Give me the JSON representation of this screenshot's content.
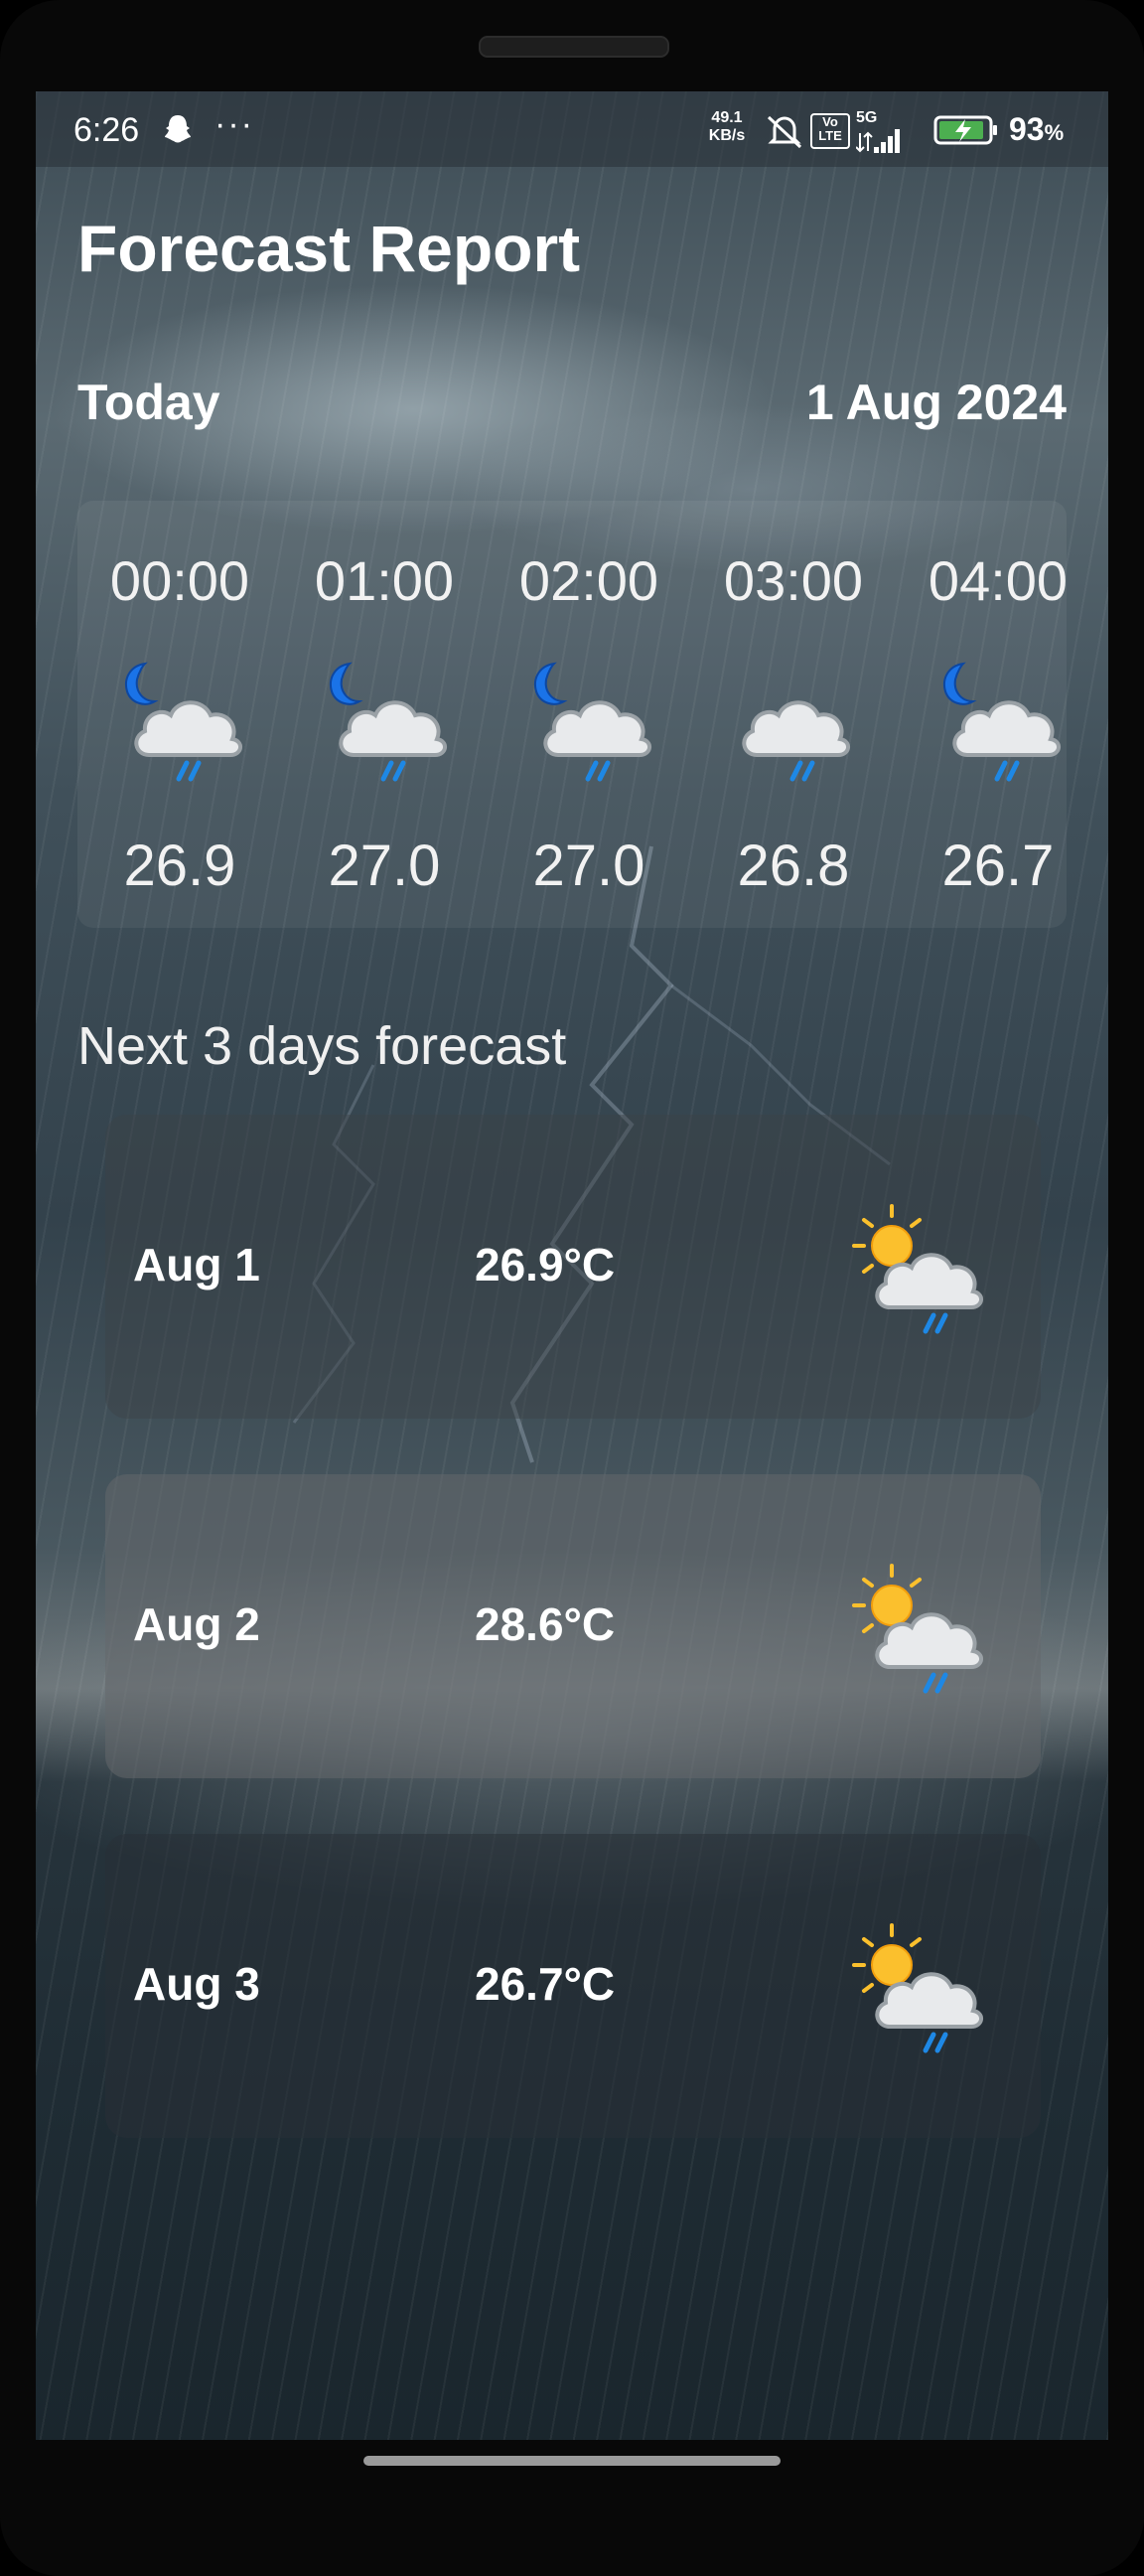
{
  "status_bar": {
    "time": "6:26",
    "overflow": "···",
    "net_speed_value": "49.1",
    "net_speed_unit": "KB/s",
    "volte": "Vo LTE",
    "network": "5G",
    "battery_percent": "93",
    "battery_percent_sign": "%",
    "icons": [
      "snapchat-ghost-icon",
      "mute-icon",
      "volte-icon",
      "signal-icon",
      "battery-charging-icon"
    ]
  },
  "page": {
    "title": "Forecast Report",
    "today_label": "Today",
    "today_date": "1 Aug 2024"
  },
  "hourly": [
    {
      "time": "00:00",
      "temp": "26.9",
      "icon": "moon-cloud-rain-icon"
    },
    {
      "time": "01:00",
      "temp": "27.0",
      "icon": "moon-cloud-rain-icon"
    },
    {
      "time": "02:00",
      "temp": "27.0",
      "icon": "moon-cloud-rain-icon"
    },
    {
      "time": "03:00",
      "temp": "26.8",
      "icon": "cloud-rain-icon"
    },
    {
      "time": "04:00",
      "temp": "26.7",
      "icon": "moon-cloud-rain-icon"
    }
  ],
  "forecast": {
    "section_title": "Next 3 days forecast",
    "days": [
      {
        "date": "Aug 1",
        "temp": "26.9°C",
        "icon": "sun-cloud-rain-icon"
      },
      {
        "date": "Aug 2",
        "temp": "28.6°C",
        "icon": "sun-cloud-rain-icon"
      },
      {
        "date": "Aug 3",
        "temp": "26.7°C",
        "icon": "sun-cloud-rain-icon"
      }
    ]
  },
  "colors": {
    "moon": "#1a73e8",
    "sun": "#fbc02d",
    "cloud": "#e8eaec",
    "rain": "#1e88e5",
    "battery": "#4caf50"
  }
}
